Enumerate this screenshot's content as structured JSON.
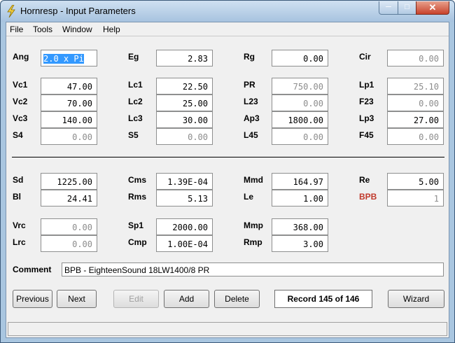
{
  "window": {
    "title": "Hornresp - Input Parameters"
  },
  "menu": [
    "File",
    "Tools",
    "Window",
    "Help"
  ],
  "fields": {
    "Ang": "2.0 x Pi",
    "Eg": "2.83",
    "Rg": "0.00",
    "Cir": "0.00",
    "Vc1": "47.00",
    "Lc1": "22.50",
    "PR": "750.00",
    "Lp1": "25.10",
    "Vc2": "70.00",
    "Lc2": "25.00",
    "L23": "0.00",
    "F23": "0.00",
    "Vc3": "140.00",
    "Lc3": "30.00",
    "Ap3": "1800.00",
    "Lp3": "27.00",
    "S4": "0.00",
    "S5": "0.00",
    "L45": "0.00",
    "F45": "0.00",
    "Sd": "1225.00",
    "Cms": "1.39E-04",
    "Mmd": "164.97",
    "Re": "5.00",
    "Bl": "24.41",
    "Rms": "5.13",
    "Le": "1.00",
    "BPB": "1",
    "Vrc": "0.00",
    "Sp1": "2000.00",
    "Mmp": "368.00",
    "Lrc": "0.00",
    "Cmp": "1.00E-04",
    "Rmp": "3.00"
  },
  "labels": {
    "Ang": "Ang",
    "Eg": "Eg",
    "Rg": "Rg",
    "Cir": "Cir",
    "Vc1": "Vc1",
    "Lc1": "Lc1",
    "PR": "PR",
    "Lp1": "Lp1",
    "Vc2": "Vc2",
    "Lc2": "Lc2",
    "L23": "L23",
    "F23": "F23",
    "Vc3": "Vc3",
    "Lc3": "Lc3",
    "Ap3": "Ap3",
    "Lp3": "Lp3",
    "S4": "S4",
    "S5": "S5",
    "L45": "L45",
    "F45": "F45",
    "Sd": "Sd",
    "Cms": "Cms",
    "Mmd": "Mmd",
    "Re": "Re",
    "Bl": "Bl",
    "Rms": "Rms",
    "Le": "Le",
    "BPB": "BPB",
    "Vrc": "Vrc",
    "Sp1": "Sp1",
    "Mmp": "Mmp",
    "Lrc": "Lrc",
    "Cmp": "Cmp",
    "Rmp": "Rmp",
    "Comment": "Comment"
  },
  "comment": "BPB - EighteenSound 18LW1400/8 PR",
  "buttons": {
    "previous": "Previous",
    "next": "Next",
    "edit": "Edit",
    "add": "Add",
    "delete": "Delete",
    "wizard": "Wizard"
  },
  "record": "Record 145 of 146",
  "colors": {
    "highlight": "#3399ff",
    "bpb_label": "#c0392b"
  }
}
